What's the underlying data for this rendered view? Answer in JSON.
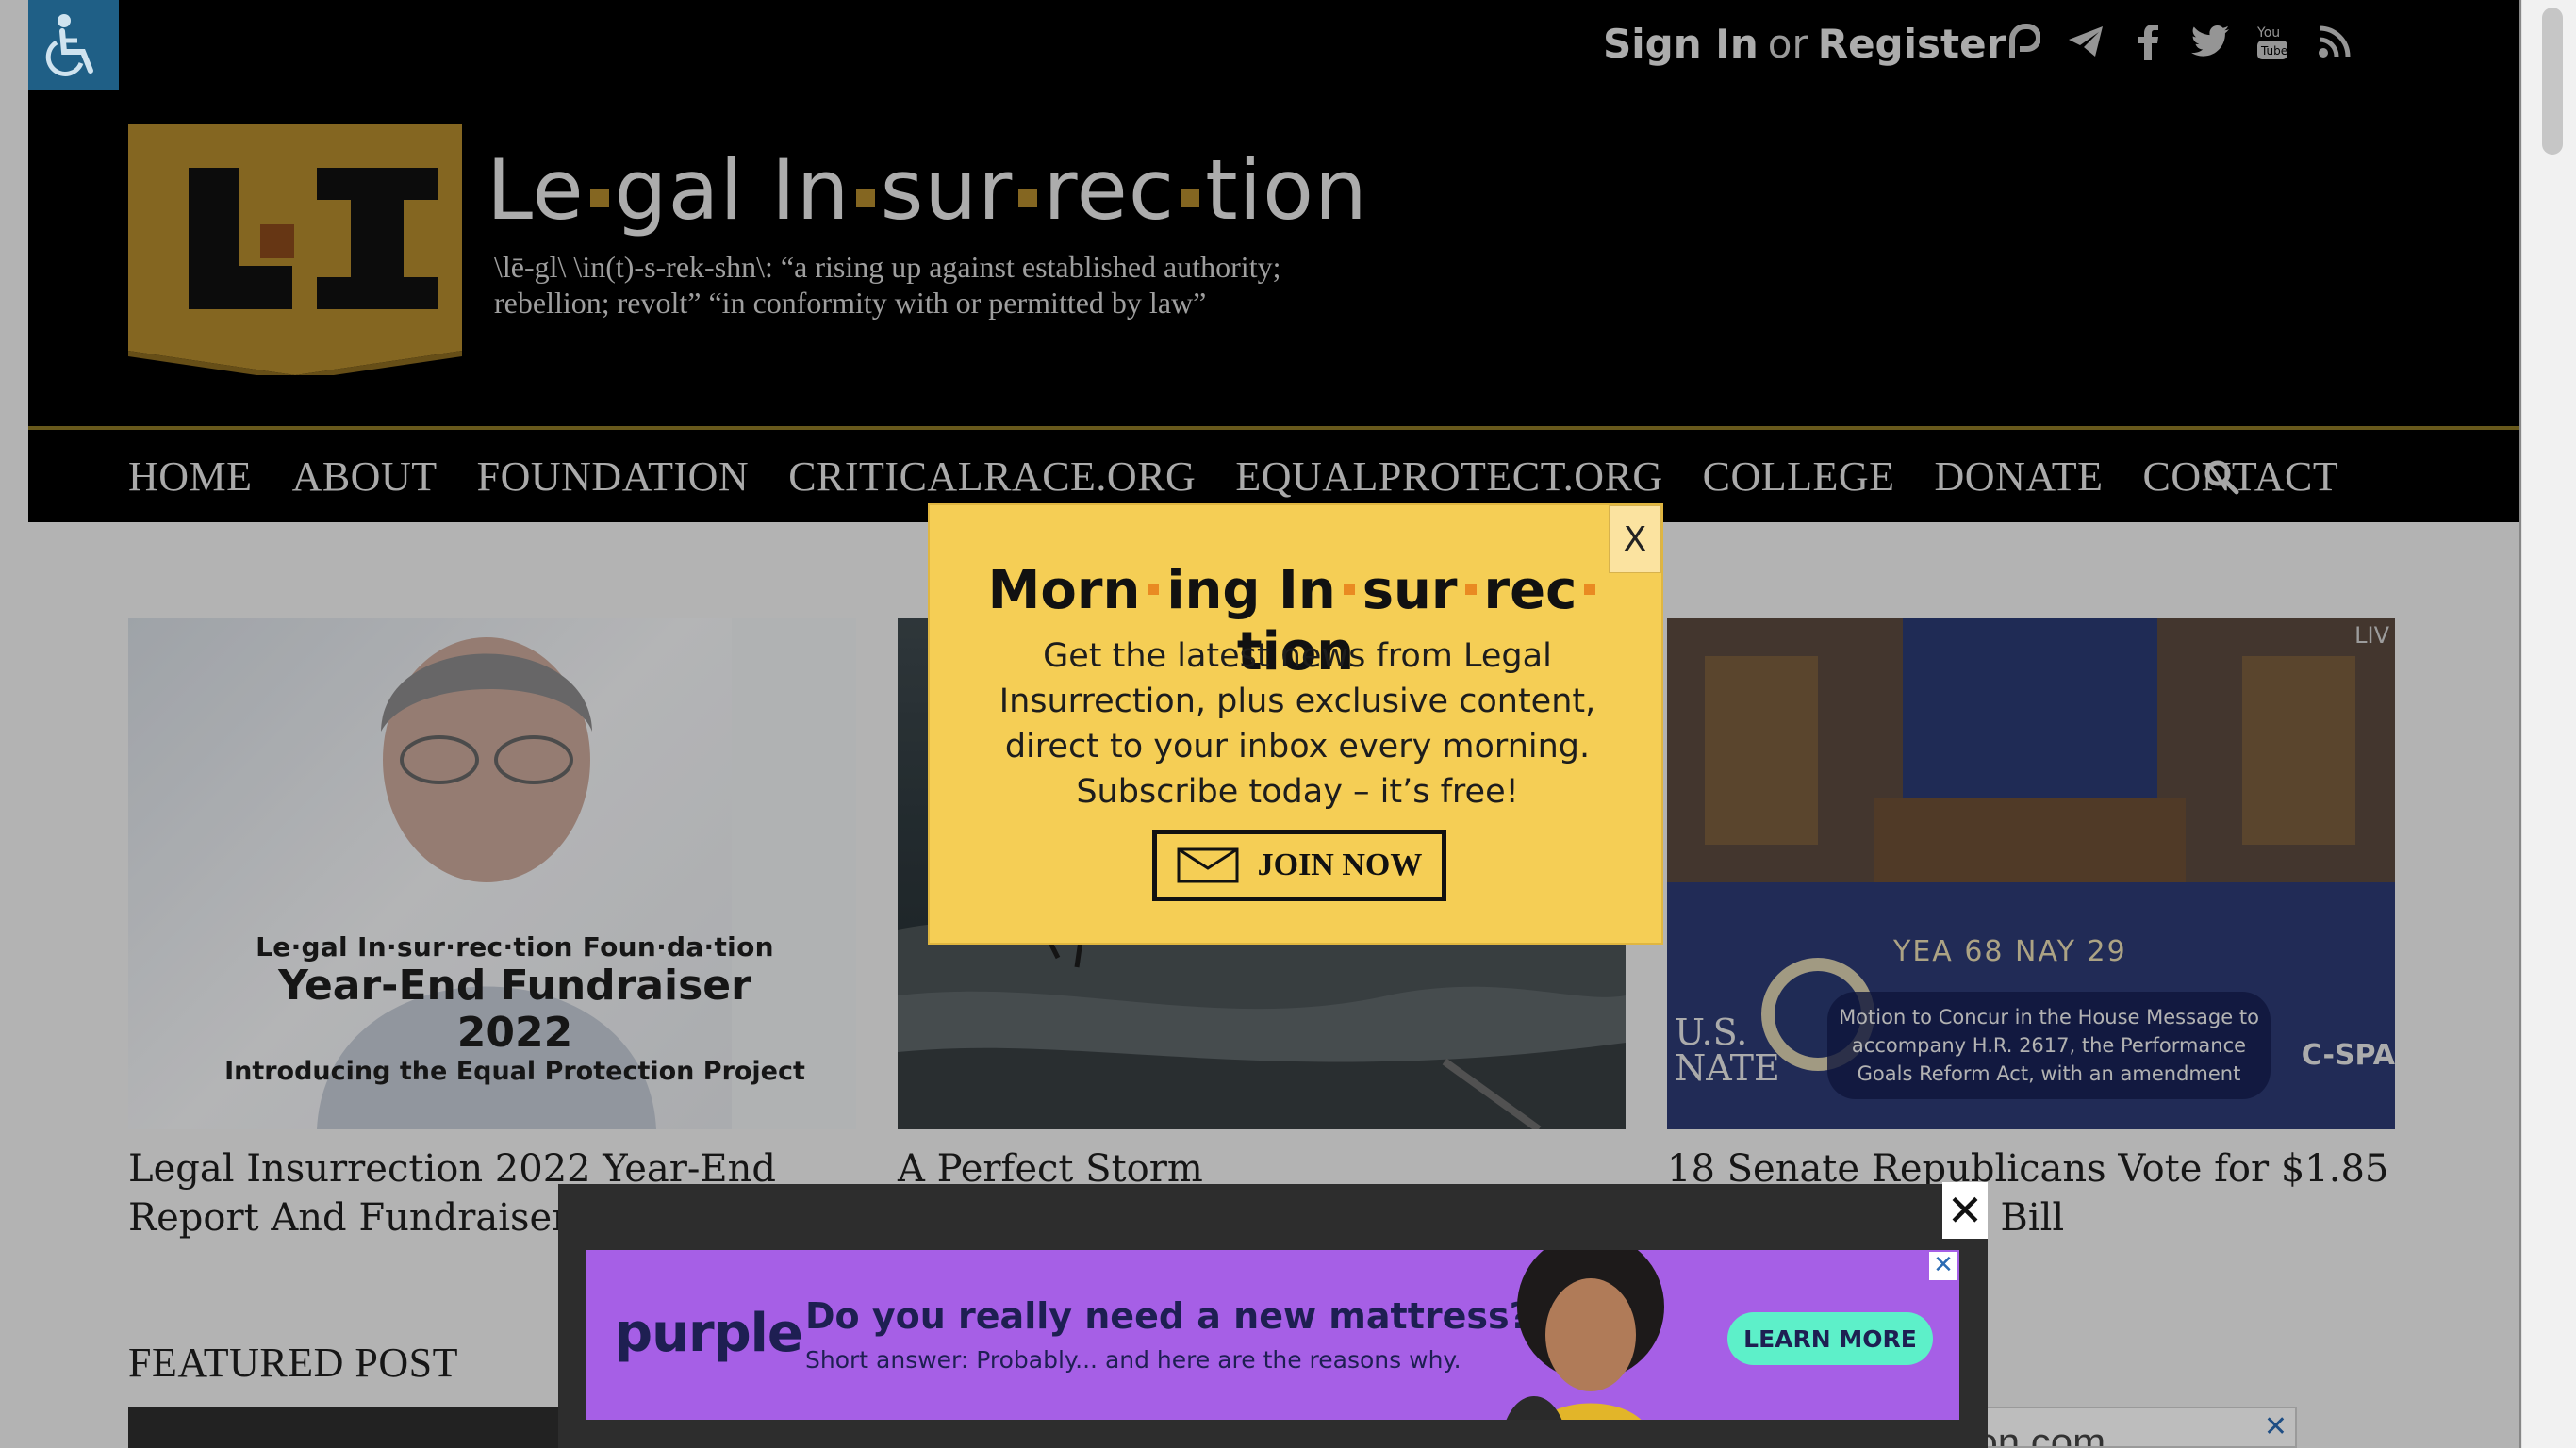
{
  "accessibility": {
    "icon": "wheelchair-icon"
  },
  "topbar": {
    "sign_in": "Sign In",
    "or": "or",
    "register": "Register"
  },
  "social": [
    "parler-icon",
    "telegram-icon",
    "facebook-icon",
    "twitter-icon",
    "youtube-icon",
    "rss-icon"
  ],
  "site": {
    "title_parts": [
      "Le",
      "gal In",
      "sur",
      "rec",
      "tion"
    ],
    "tagline_line1": "\\lē-gl\\ \\in(t)-s-rek-shn\\: “a rising up against established authority;",
    "tagline_line2": "rebellion; revolt” “in conformity with or permitted by law”",
    "logo_text": "L·I"
  },
  "nav": {
    "items": [
      "HOME",
      "ABOUT",
      "FOUNDATION",
      "CRITICALRACE.ORG",
      "EQUALPROTECT.ORG",
      "COLLEGE",
      "DONATE",
      "CONTACT"
    ],
    "search_icon": "search-icon"
  },
  "cards": [
    {
      "title": "Legal Insurrection 2022 Year-End Report And Fundraiser",
      "image": {
        "line1": "Le·gal In·sur·rec·tion Foun·da·tion",
        "line2": "Year-End Fundraiser 2022",
        "line3": "Introducing the Equal Protection Project"
      }
    },
    {
      "title": "A Perfect Storm"
    },
    {
      "title": "18 Senate Republicans Vote for $1.85 Trillion Omnibus Bill",
      "image": {
        "vote": "YEA 68   NAY 29",
        "message": "Motion to Concur in the House Message to accompany H.R. 2617, the Performance Goals Reform Act, with an amendment",
        "us_label": "U.S.\nNATE",
        "network": "C-SPA",
        "live": "LIV"
      }
    }
  ],
  "featured": {
    "heading": "FEATURED POST"
  },
  "amazon_ad": {
    "text": "Amazon.com",
    "close": "✕"
  },
  "modal": {
    "title_parts": [
      "Morn",
      "ing In",
      "sur",
      "rec",
      "tion"
    ],
    "body": "Get the latest news from Legal Insurrection, plus exclusive content, direct to your inbox every morning. Subscribe today – it’s free!",
    "button_label": "JOIN NOW",
    "close_label": "X"
  },
  "ad": {
    "close_label": "✕",
    "logo": "purple",
    "headline": "Do you really need a new mattress?",
    "subline": "Short answer: Probably... and here are the reasons why.",
    "cta": "LEARN MORE",
    "choice_label": "✕"
  },
  "colors": {
    "header_bg": "#000000",
    "gold": "#b38a2d",
    "modal_bg": "#f5ce55",
    "ad_bg": "#a65fe6",
    "cta_bg": "#5df0c9"
  }
}
